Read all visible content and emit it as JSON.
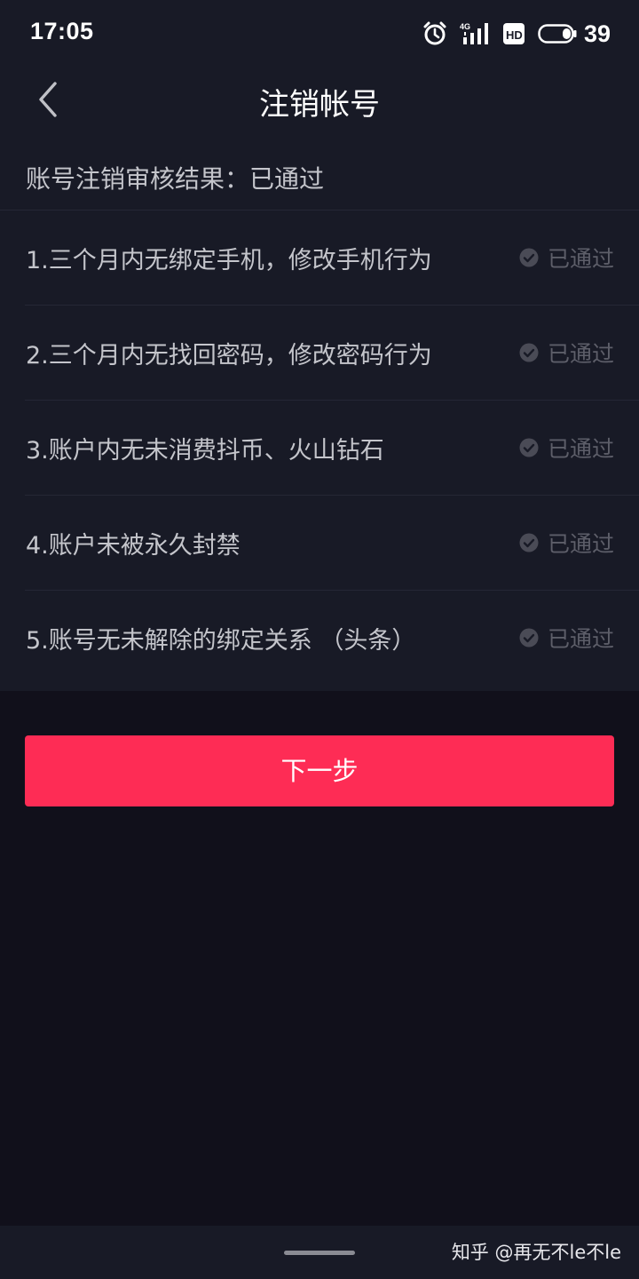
{
  "status_bar": {
    "time": "17:05",
    "battery_level": "39",
    "icons": [
      "alarm-icon",
      "signal-4g-icon",
      "hd-icon",
      "battery-icon"
    ]
  },
  "nav": {
    "back_icon": "chevron-left-icon",
    "title": "注销帐号"
  },
  "summary": {
    "text": "账号注销审核结果：已通过"
  },
  "checks": [
    {
      "label": "1.三个月内无绑定手机，修改手机行为",
      "status": "已通过"
    },
    {
      "label": "2.三个月内无找回密码，修改密码行为",
      "status": "已通过"
    },
    {
      "label": "3.账户内无未消费抖币、火山钻石",
      "status": "已通过"
    },
    {
      "label": "4.账户未被永久封禁",
      "status": "已通过"
    },
    {
      "label": "5.账号无未解除的绑定关系 （头条）",
      "status": "已通过"
    }
  ],
  "next_button": {
    "label": "下一步"
  },
  "bottom": {
    "watermark": "知乎 @再无不le不le"
  },
  "colors": {
    "accent": "#fe2c55",
    "card_bg": "#181a26",
    "page_bg": "#11101b",
    "muted_text": "#5d5e69",
    "body_text": "#c4c5cb"
  }
}
